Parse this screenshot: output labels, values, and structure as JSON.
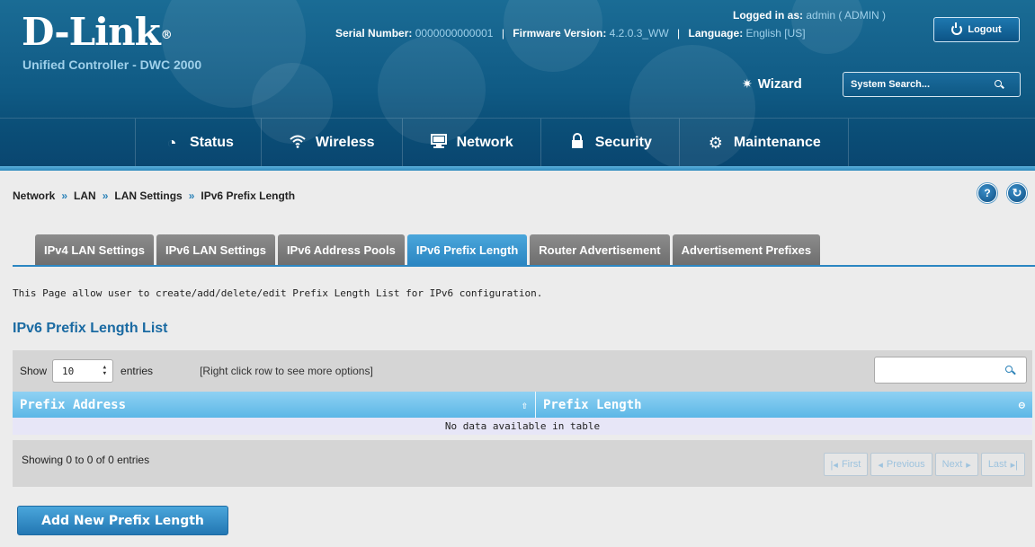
{
  "header": {
    "brand": "D-Link",
    "brand_mark": "®",
    "product": "Unified Controller - DWC 2000",
    "serial_label": "Serial Number:",
    "serial_value": "0000000000001",
    "firmware_label": "Firmware Version:",
    "firmware_value": "4.2.0.3_WW",
    "language_label": "Language:",
    "language_value": "English [US]",
    "logged_label": "Logged in as:",
    "logged_value": "admin ( ADMIN )",
    "logout_label": "Logout",
    "wizard_label": "Wizard",
    "search_placeholder": "System Search..."
  },
  "nav": {
    "items": [
      {
        "label": "Status",
        "icon": "gauge-icon"
      },
      {
        "label": "Wireless",
        "icon": "wifi-icon"
      },
      {
        "label": "Network",
        "icon": "monitor-icon"
      },
      {
        "label": "Security",
        "icon": "lock-icon"
      },
      {
        "label": "Maintenance",
        "icon": "gears-icon"
      }
    ]
  },
  "breadcrumb": {
    "items": [
      "Network",
      "LAN",
      "LAN Settings",
      "IPv6 Prefix Length"
    ],
    "separator": "»"
  },
  "tabs": [
    {
      "label": "IPv4 LAN Settings",
      "active": false
    },
    {
      "label": "IPv6 LAN Settings",
      "active": false
    },
    {
      "label": "IPv6 Address Pools",
      "active": false
    },
    {
      "label": "IPv6 Prefix Length",
      "active": true
    },
    {
      "label": "Router Advertisement",
      "active": false
    },
    {
      "label": "Advertisement Prefixes",
      "active": false
    }
  ],
  "page": {
    "description": "This Page allow user to create/add/delete/edit Prefix Length List for IPv6 configuration.",
    "list_title": "IPv6 Prefix Length List"
  },
  "table": {
    "show_label": "Show",
    "show_value": "10",
    "entries_label": "entries",
    "hint": "[Right click row to see more options]",
    "search_value": "",
    "columns": [
      "Prefix Address",
      "Prefix Length"
    ],
    "empty_text": "No data available in table",
    "showing_text": "Showing 0 to 0 of 0 entries",
    "pager": {
      "first": "First",
      "previous": "Previous",
      "next": "Next",
      "last": "Last"
    }
  },
  "actions": {
    "add_label": "Add New Prefix Length"
  },
  "colors": {
    "accent": "#2b86c2",
    "header_bg": "#0f5a84",
    "tab_inactive": "#7a7a7a",
    "table_header": "#5cb7e6"
  }
}
